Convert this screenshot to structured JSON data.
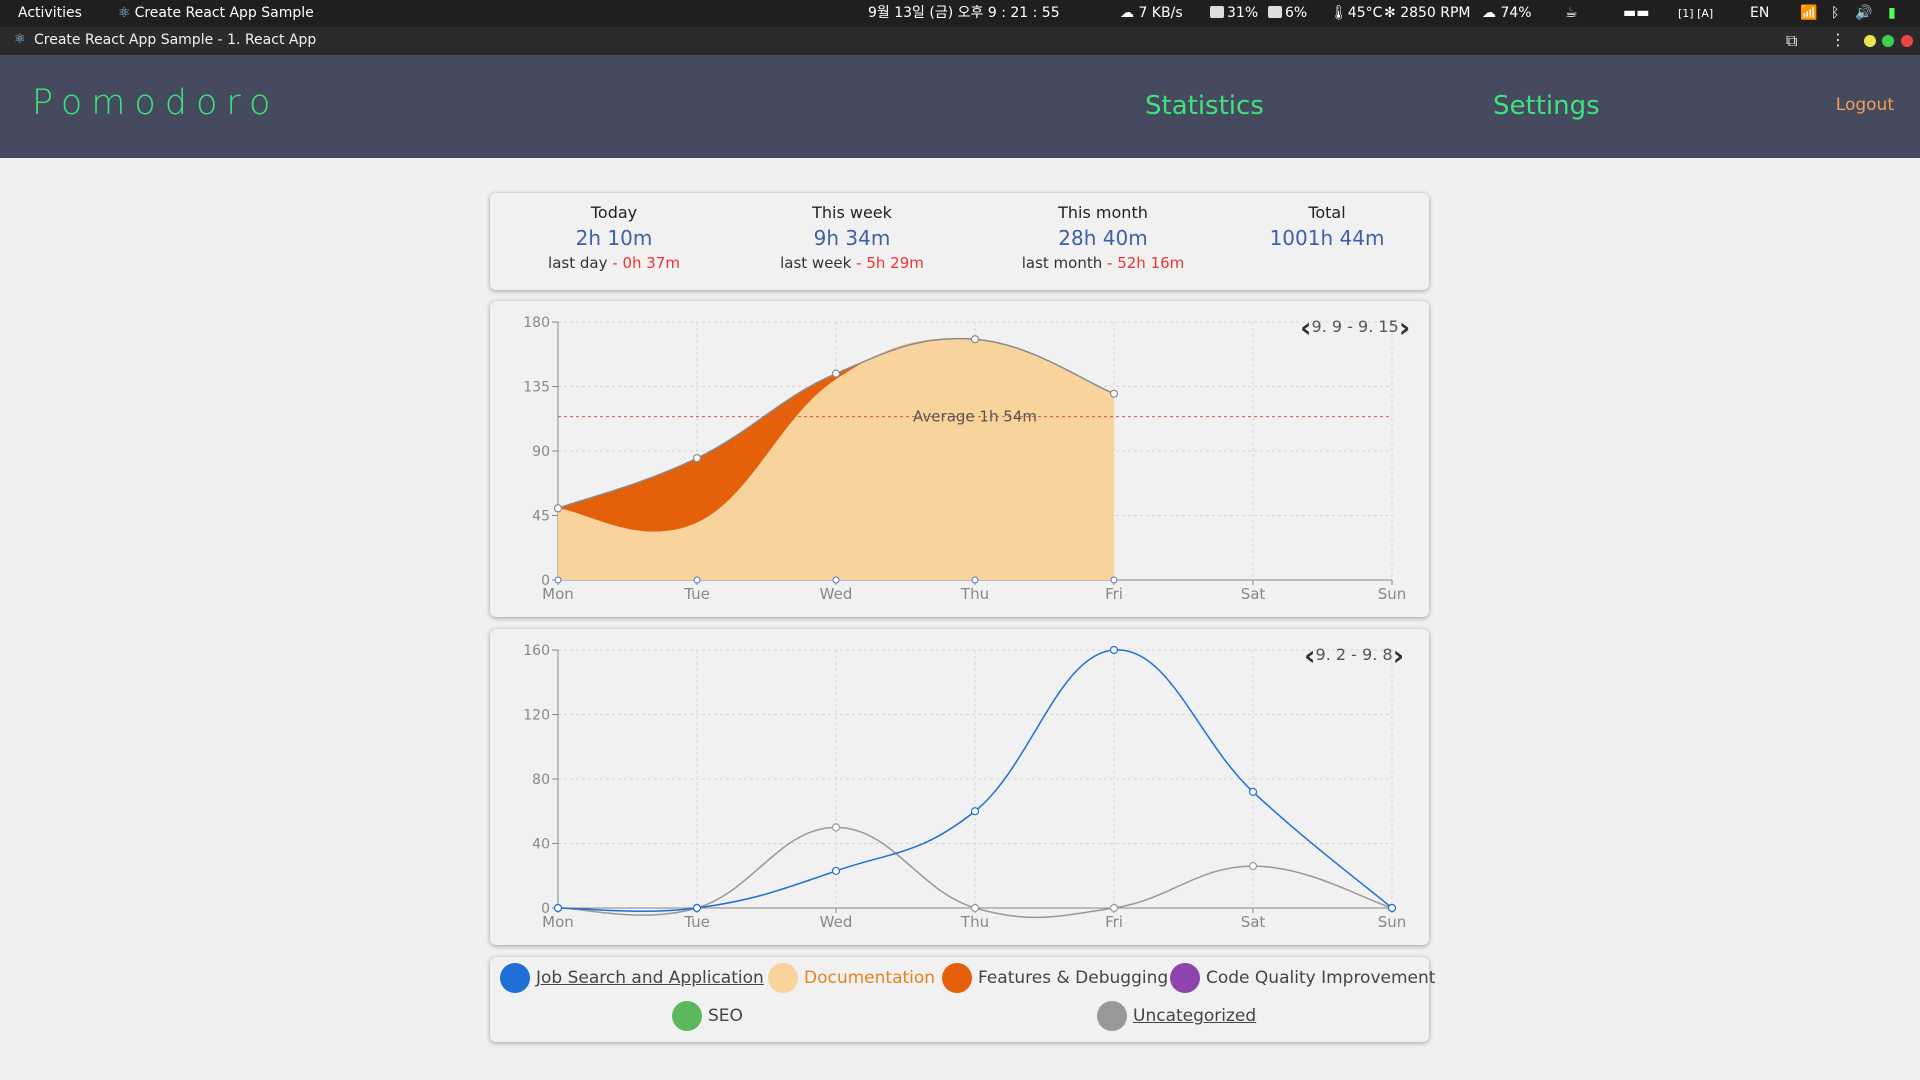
{
  "topbar": {
    "activities": "Activities",
    "app_name": "Create React App Sample",
    "datetime": "9월 13일 (금) 오후 9 : 21 : 55",
    "net": "7 KB/s",
    "cpu": "31%",
    "disk": "6%",
    "temp": "45°C",
    "fan": "2850 RPM",
    "weather": "74%",
    "lang": "EN"
  },
  "window": {
    "title": "Create React App Sample - 1. React App"
  },
  "app": {
    "brand": "Pomodoro",
    "nav": {
      "statistics": "Statistics",
      "settings": "Settings",
      "logout": "Logout"
    }
  },
  "summary": [
    {
      "label": "Today",
      "value": "2h 10m",
      "prev_label": "last day",
      "prev_value": "0h 37m"
    },
    {
      "label": "This week",
      "value": "9h 34m",
      "prev_label": "last week",
      "prev_value": "5h 29m"
    },
    {
      "label": "This month",
      "value": "28h 40m",
      "prev_label": "last month",
      "prev_value": "52h 16m"
    },
    {
      "label": "Total",
      "value": "1001h 44m",
      "prev_label": "",
      "prev_value": ""
    }
  ],
  "colors": {
    "header_bg": "#454a5e",
    "brand": "#3ee27d",
    "logout": "#f0a050",
    "documentation": "#f8d39b",
    "features": "#e4600a",
    "job_search": "#1f6fd6",
    "uncategorized": "#999999"
  },
  "chart_data": [
    {
      "type": "area",
      "range_label": "9. 9 - 9. 15",
      "categories": [
        "Mon",
        "Tue",
        "Wed",
        "Thu",
        "Fri",
        "Sat",
        "Sun"
      ],
      "ylim": [
        0,
        180
      ],
      "yticks": [
        0,
        45,
        90,
        135,
        180
      ],
      "stacked": true,
      "series": [
        {
          "name": "Documentation",
          "color": "#f8d39b",
          "values": [
            50,
            40,
            140,
            168,
            130,
            null,
            null
          ]
        },
        {
          "name": "Features & Debugging",
          "color": "#e4600a",
          "values": [
            0,
            45,
            4,
            0,
            0,
            null,
            null
          ]
        }
      ],
      "total": [
        50,
        85,
        144,
        168,
        130,
        null,
        null
      ],
      "average_line": {
        "value": 114,
        "label": "Average 1h 54m",
        "color": "#d9534f"
      },
      "grid": true
    },
    {
      "type": "line",
      "range_label": "9. 2 - 9. 8",
      "categories": [
        "Mon",
        "Tue",
        "Wed",
        "Thu",
        "Fri",
        "Sat",
        "Sun"
      ],
      "ylim": [
        0,
        160
      ],
      "yticks": [
        0,
        40,
        80,
        120,
        160
      ],
      "series": [
        {
          "name": "Job Search and Application",
          "color": "#1f6fd6",
          "values": [
            0,
            0,
            23,
            60,
            160,
            72,
            0
          ]
        },
        {
          "name": "Uncategorized",
          "color": "#999999",
          "values": [
            0,
            0,
            50,
            0,
            0,
            26,
            0
          ]
        }
      ],
      "grid": true
    }
  ],
  "legend": [
    {
      "name": "Job Search and Application",
      "color": "#1f6fd6",
      "text_color": "#444444",
      "underline": true
    },
    {
      "name": "Documentation",
      "color": "#f8d39b",
      "text_color": "#e8821e",
      "underline": false
    },
    {
      "name": "Features & Debugging",
      "color": "#e4600a",
      "text_color": "#444444",
      "underline": false
    },
    {
      "name": "Code Quality Improvement",
      "color": "#8e44ad",
      "text_color": "#444444",
      "underline": false
    },
    {
      "name": "SEO",
      "color": "#5cb85c",
      "text_color": "#444444",
      "underline": false
    },
    {
      "name": "Uncategorized",
      "color": "#999999",
      "text_color": "#444444",
      "underline": true
    }
  ]
}
